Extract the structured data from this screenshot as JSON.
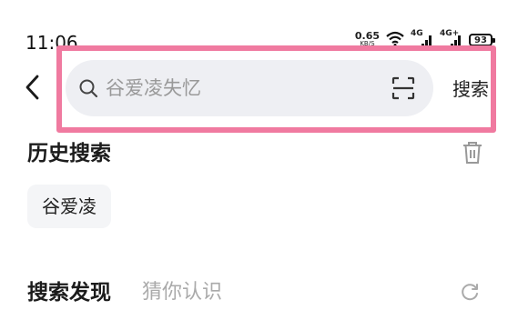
{
  "status_bar": {
    "time": "11:06",
    "net_speed_value": "0.65",
    "net_speed_unit": "KB/S",
    "wifi_icon": "wifi-icon",
    "signal1_label": "4G",
    "signal2_label": "4G+",
    "battery_level": "93"
  },
  "header": {
    "back_icon": "chevron-left-icon",
    "search": {
      "placeholder": "谷爱凌失忆",
      "value": "",
      "search_icon": "search-icon",
      "scan_icon": "scan-icon"
    },
    "search_button_label": "搜索"
  },
  "history": {
    "title": "历史搜索",
    "clear_icon": "trash-icon",
    "items": [
      "谷爱凌"
    ]
  },
  "discover": {
    "title": "搜索发现",
    "subtitle": "猜你认识",
    "refresh_icon": "refresh-icon"
  },
  "colors": {
    "highlight": "#f07aa0",
    "search_bg": "#eeeff3",
    "chip_bg": "#f4f5f7",
    "subtitle": "#aaaaaa"
  }
}
